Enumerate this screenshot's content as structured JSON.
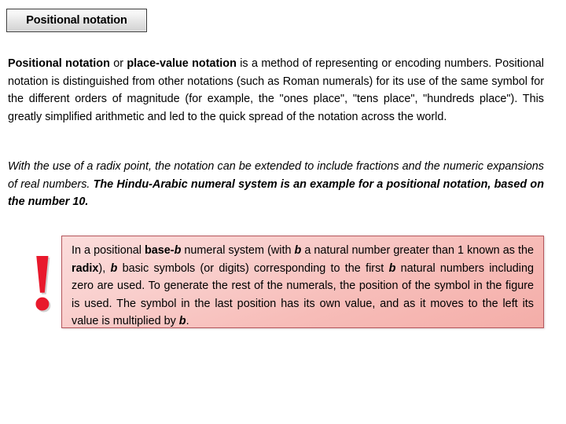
{
  "slide": {
    "title": "Positional notation"
  },
  "paragraphs": {
    "main": {
      "lead_bold_1": "Positional notation",
      "mid_1": " or ",
      "lead_bold_2": "place-value notation",
      "rest": " is a method of representing or encoding numbers. Positional notation is distinguished from other notations (such as Roman numerals) for its use of the same symbol for the different orders of magnitude (for example, the \"ones place\", \"tens place\", \"hundreds place\"). This greatly simplified arithmetic and led to the quick spread of the notation across the world."
    },
    "italic": {
      "plain": "With the use of a radix point, the notation can be extended to include fractions and the numeric expansions of real numbers. ",
      "bold": "The Hindu-Arabic numeral system is an example for a positional notation, based on the number 10."
    }
  },
  "callout": {
    "icon": "exclamation-mark-icon",
    "icon_glyph": "!",
    "accent_color": "#e8192c",
    "border_color": "#b5565c",
    "background_top_color": "#fbdcdb",
    "background_bottom_color": "#f4ada8",
    "text": {
      "s1": "In a positional ",
      "b1": "base-",
      "bi1": "b",
      "s2": " numeral system (with ",
      "bi2": "b",
      "s3": " a natural number greater than 1 known as the ",
      "b2": "radix",
      "s4": "), ",
      "bi3": "b",
      "s5": " basic symbols (or digits) corresponding to the first ",
      "bi4": "b",
      "s6": " natural numbers including zero are used. To generate the rest of the numerals, the position of the symbol in the figure is used. The symbol in the last position has its own value, and as it moves to the left its value is multiplied by ",
      "bi5": "b",
      "s7": "."
    }
  }
}
